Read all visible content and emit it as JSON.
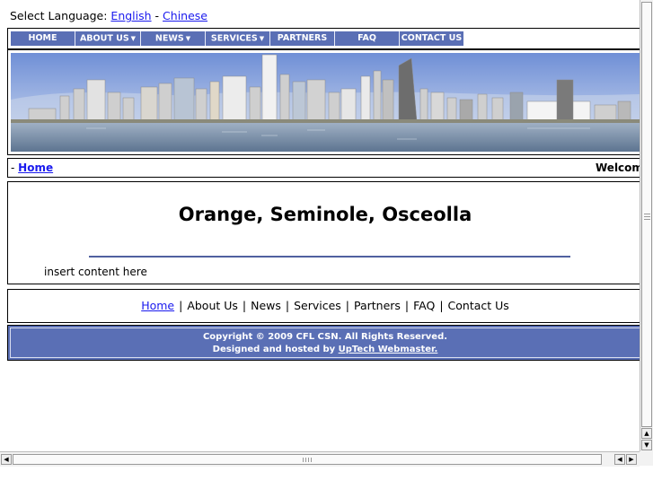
{
  "language": {
    "prefix": "Select Language:",
    "english": "English",
    "dash": "-",
    "chinese": "Chinese"
  },
  "nav": [
    {
      "label": "HOME",
      "caret": false
    },
    {
      "label": "ABOUT US",
      "caret": true
    },
    {
      "label": "NEWS",
      "caret": true
    },
    {
      "label": "SERVICES",
      "caret": true
    },
    {
      "label": "PARTNERS",
      "caret": false
    },
    {
      "label": "FAQ",
      "caret": false
    },
    {
      "label": "CONTACT US",
      "caret": false
    }
  ],
  "breadcrumb": {
    "prefix": "-",
    "home": "Home"
  },
  "welcome": "Welcome",
  "content": {
    "title": "Orange, Seminole, Osceolla",
    "text": "insert content here"
  },
  "footer_nav": [
    "Home",
    "About Us",
    "News",
    "Services",
    "Partners",
    "FAQ",
    "Contact Us"
  ],
  "footer_sep": "|",
  "copyright": {
    "line1": "Copyright © 2009 CFL CSN. All Rights Reserved.",
    "line2_prefix": "Designed and hosted by",
    "line2_link": "UpTech Webmaster."
  },
  "colors": {
    "nav_bg": "#5a6fb5",
    "link": "#1a1aee",
    "rule": "#5060a0"
  },
  "icons": {
    "caret": "caret-down-icon",
    "scroll_up": "arrow-up-icon",
    "scroll_down": "arrow-down-icon",
    "scroll_left": "arrow-left-icon",
    "scroll_right": "arrow-right-icon"
  }
}
